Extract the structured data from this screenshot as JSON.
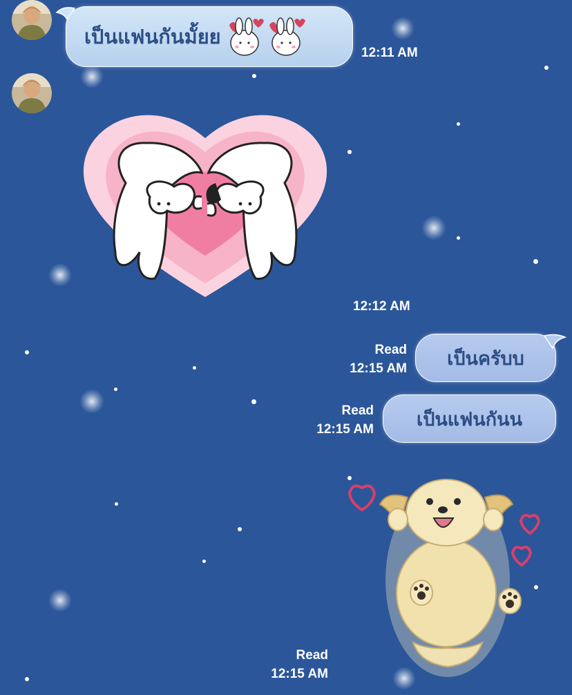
{
  "messages": [
    {
      "side": "in",
      "type": "text",
      "text": "เป็นแฟนกันมั้ยย",
      "time": "12:11 AM",
      "sticker": "two-bunnies-with-hearts-emoji"
    },
    {
      "side": "in",
      "type": "sticker",
      "sticker": "bunnies-hugging-heart-sticker",
      "time": "12:12 AM"
    },
    {
      "side": "out",
      "type": "text",
      "text": "เป็นครับบ",
      "status": "Read",
      "time": "12:15 AM"
    },
    {
      "side": "out",
      "type": "text",
      "text": "เป็นแฟนกันน",
      "status": "Read",
      "time": "12:15 AM"
    },
    {
      "side": "out",
      "type": "sticker",
      "sticker": "puppy-with-hearts-sticker",
      "status": "Read",
      "time": "12:15 AM"
    }
  ],
  "colors": {
    "background": "#2b5699",
    "incoming_bubble": "#c6ddf3",
    "outgoing_bubble": "#afc5eb",
    "bubble_text": "#2d4f86",
    "meta_text": "#ffffff"
  }
}
